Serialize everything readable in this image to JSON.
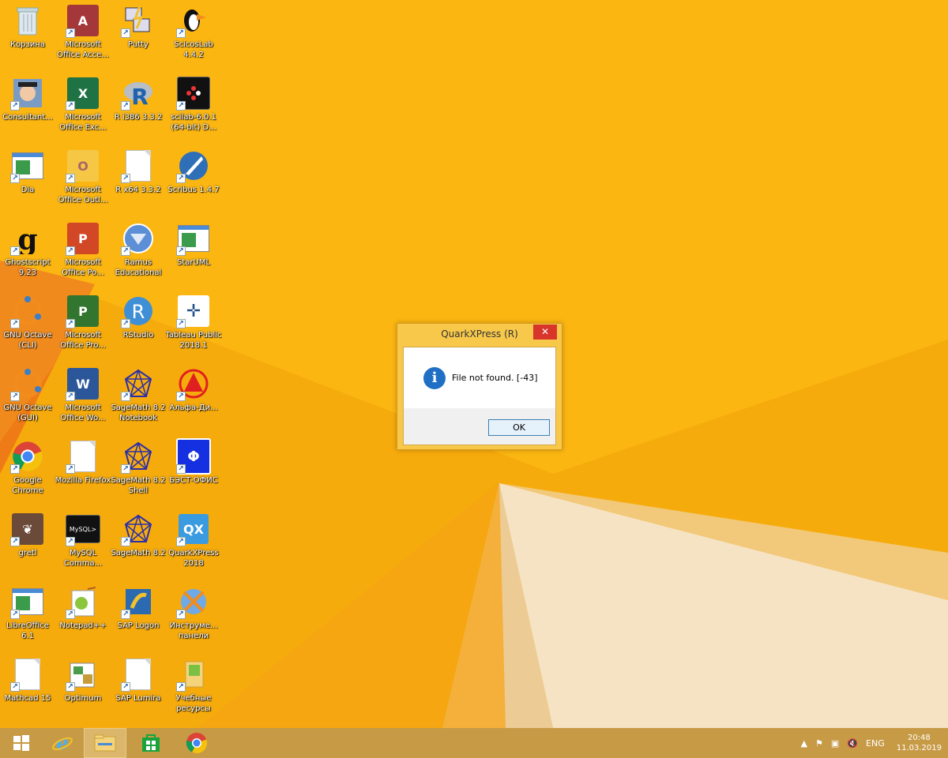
{
  "desktop": {
    "icons": [
      {
        "label": "Корзина",
        "icon": "recycle-bin-icon"
      },
      {
        "label": "Microsoft Office Acce...",
        "icon": "access-icon"
      },
      {
        "label": "Putty",
        "icon": "putty-icon"
      },
      {
        "label": "ScicosLab 4.4.2",
        "icon": "scicoslab-icon"
      },
      {
        "label": "Consultant...",
        "icon": "consultant-icon"
      },
      {
        "label": "Microsoft Office Exc...",
        "icon": "excel-icon"
      },
      {
        "label": "R i386 3.3.2",
        "icon": "r-icon"
      },
      {
        "label": "scilab-6.0.1 (64-bit) D...",
        "icon": "scilab-icon"
      },
      {
        "label": "Dia",
        "icon": "dia-icon"
      },
      {
        "label": "Microsoft Office Outl...",
        "icon": "outlook-icon"
      },
      {
        "label": "R x64 3.3.2",
        "icon": "document-icon"
      },
      {
        "label": "Scribus 1.4.7",
        "icon": "scribus-icon"
      },
      {
        "label": "Ghostscript 9.23",
        "icon": "ghostscript-icon"
      },
      {
        "label": "Microsoft Office Po...",
        "icon": "powerpoint-icon"
      },
      {
        "label": "Ramus Educational",
        "icon": "ramus-icon"
      },
      {
        "label": "StarUML",
        "icon": "staruml-icon"
      },
      {
        "label": "GNU Octave (CLI)",
        "icon": "octave-icon"
      },
      {
        "label": "Microsoft Office Pro...",
        "icon": "project-icon"
      },
      {
        "label": "RStudio",
        "icon": "rstudio-icon"
      },
      {
        "label": "Tableau Public 2018.1",
        "icon": "tableau-icon"
      },
      {
        "label": "GNU Octave (GUI)",
        "icon": "octave-icon"
      },
      {
        "label": "Microsoft Office Wo...",
        "icon": "word-icon"
      },
      {
        "label": "SageMath 8.2 Notebook",
        "icon": "sagemath-icon"
      },
      {
        "label": "Альфа-Ди...",
        "icon": "alfa-icon"
      },
      {
        "label": "Google Chrome",
        "icon": "chrome-icon"
      },
      {
        "label": "Mozilla Firefox",
        "icon": "document-icon"
      },
      {
        "label": "SageMath 8.2 Shell",
        "icon": "sagemath-icon"
      },
      {
        "label": "БЭСТ-ОФИС",
        "icon": "best-office-icon"
      },
      {
        "label": "gretl",
        "icon": "gretl-icon"
      },
      {
        "label": "MySQL Comma...",
        "icon": "mysql-icon"
      },
      {
        "label": "SageMath 8.2",
        "icon": "sagemath-icon"
      },
      {
        "label": "QuarkXPress 2018",
        "icon": "quarkxpress-icon"
      },
      {
        "label": "LibreOffice 6.1",
        "icon": "libreoffice-icon"
      },
      {
        "label": "Notepad++",
        "icon": "notepadpp-icon"
      },
      {
        "label": "SAP Logon",
        "icon": "sap-logon-icon"
      },
      {
        "label": "Инструме... панели",
        "icon": "tools-icon"
      },
      {
        "label": "Mathcad 15",
        "icon": "document-icon"
      },
      {
        "label": "Optimum",
        "icon": "optimum-icon"
      },
      {
        "label": "SAP Lumira",
        "icon": "document-icon"
      },
      {
        "label": "Учебные ресурсы",
        "icon": "folder-icon"
      }
    ]
  },
  "dialog": {
    "title": "QuarkXPress (R)",
    "message": "File not found. [-43]",
    "ok_label": "OK",
    "close_glyph": "✕",
    "info_glyph": "i"
  },
  "taskbar": {
    "items": [
      {
        "name": "start-button",
        "icon": "windows-logo-icon"
      },
      {
        "name": "taskbar-ie",
        "icon": "internet-explorer-icon"
      },
      {
        "name": "taskbar-explorer",
        "icon": "file-explorer-icon"
      },
      {
        "name": "taskbar-store",
        "icon": "store-icon"
      },
      {
        "name": "taskbar-chrome",
        "icon": "chrome-icon"
      }
    ],
    "tray": {
      "language": "ENG",
      "time": "20:48",
      "date": "11.03.2019"
    }
  },
  "colors": {
    "wallpaper": "#f6ab0c",
    "taskbar": "#c79a46",
    "dialog_frame": "#f7c84a",
    "close_button": "#d9362b",
    "info_icon": "#1f6fc4"
  }
}
